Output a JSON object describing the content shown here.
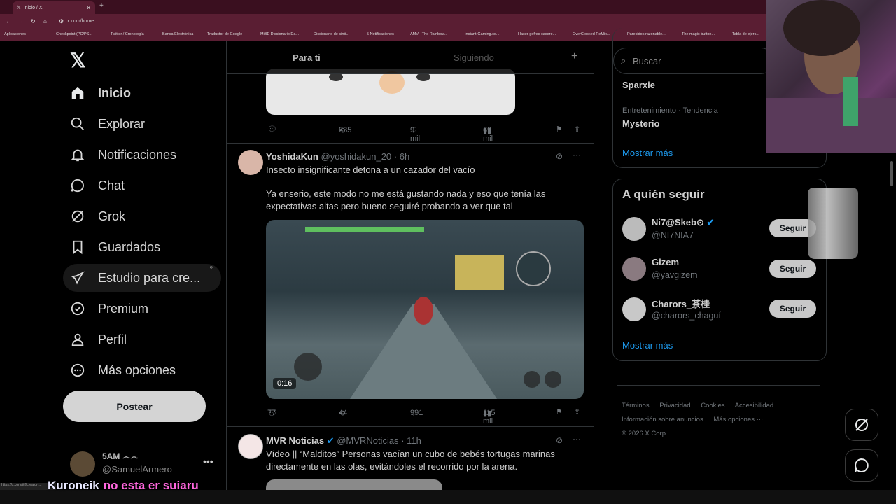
{
  "browser": {
    "tab_title": "Inicio / X",
    "url": "x.com/home",
    "bookmarks": [
      "Aplicaciones",
      "Checkpoint (PC/PS...",
      "Twitter / Cronología",
      "Banca Electrónica",
      "Traductor de Google",
      "MiBE Diccionario Da...",
      "Diccionario de sinó...",
      "5 Notificaciones",
      "AMV - The Rainbow...",
      "Instant-Gaming.co...",
      "Hacer gofres casero...",
      "OverClocked ReMix...",
      "Parecidos razonable...",
      "The magic button...",
      "Tabla de ejerc..."
    ]
  },
  "nav": {
    "items": [
      {
        "label": "Inicio",
        "icon": "home-icon"
      },
      {
        "label": "Explorar",
        "icon": "search-icon"
      },
      {
        "label": "Notificaciones",
        "icon": "bell-icon"
      },
      {
        "label": "Chat",
        "icon": "chat-bubble-icon"
      },
      {
        "label": "Grok",
        "icon": "grok-icon"
      },
      {
        "label": "Guardados",
        "icon": "bookmark-icon"
      },
      {
        "label": "Estudio para cre...",
        "icon": "rocket-icon"
      },
      {
        "label": "Premium",
        "icon": "verified-badge-icon"
      },
      {
        "label": "Perfil",
        "icon": "person-icon"
      },
      {
        "label": "Más opciones",
        "icon": "more-circle-icon"
      }
    ],
    "post_label": "Postear",
    "account": {
      "name": "5AM ෴෴",
      "handle": "@SamuelArmero"
    }
  },
  "timeline": {
    "tabs": [
      "Para ti",
      "Siguiendo"
    ],
    "post0": {
      "replies": "",
      "reposts": "835",
      "likes": "9 mil",
      "views": "69 mil"
    },
    "post1": {
      "name": "YoshidaKun",
      "handle": "@yoshidakun_20",
      "time": "· 6h",
      "text1": "Insecto insignificante detona a un cazador del vacío",
      "text2": "Ya enserio, este modo no me está gustando nada y eso que tenía las expectativas altas pero bueno seguiré probando a ver que tal",
      "video_duration": "0:16",
      "replies": "77",
      "reposts": "44",
      "likes": "991",
      "views": "115 mil"
    },
    "post2": {
      "name": "MVR Noticias",
      "handle": "@MVRNoticias",
      "time": "· 11h",
      "text": "Vídeo || “Malditos” Personas vacían un cubo de bebés tortugas marinas directamente en las olas, evitándoles el recorrido por la arena."
    }
  },
  "right": {
    "search_placeholder": "Buscar",
    "trends": [
      {
        "meta": "",
        "name": "Sparxie"
      },
      {
        "meta": "Entretenimiento · Tendencia",
        "name": "Mysterio"
      }
    ],
    "trends_more": "Mostrar más",
    "who_title": "A quién seguir",
    "follow": [
      {
        "name": "Ni7@Skeb⊙",
        "handle": "@NI7NIA7",
        "btn": "Seguir"
      },
      {
        "name": "Gizem",
        "handle": "@yavgizem",
        "btn": "Seguir"
      },
      {
        "name": "Charors_茶桂",
        "handle": "@charors_chaguí",
        "btn": "Seguir"
      }
    ],
    "follow_more": "Mostrar más",
    "footer": [
      "Términos",
      "Privacidad",
      "Cookies",
      "Accesibilidad",
      "Información sobre anuncios",
      "Más opciones ···",
      "© 2026 X Corp."
    ]
  },
  "overlay": {
    "chat_user": "Kuroneik",
    "chat_msg": "no esta er suiaru",
    "status_url": "https://x.com/i/jf/creator-..."
  },
  "colors": {
    "accent": "#1d9bf0",
    "chrome": "#5a1e33",
    "text": "#e7e9ea"
  }
}
